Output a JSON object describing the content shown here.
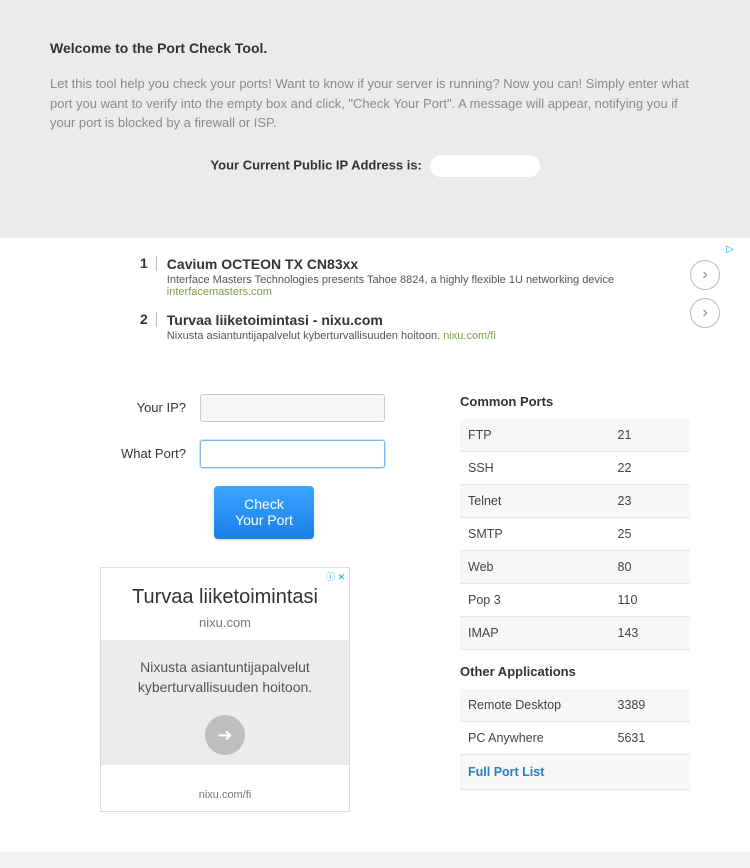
{
  "hero": {
    "title": "Welcome to the Port Check Tool.",
    "desc": "Let this tool help you check your ports! Want to know if your server is running? Now you can! Simply enter what port you want to verify into the empty box and click, \"Check Your Port\". A message will appear, notifying you if your port is blocked by a firewall or ISP.",
    "ip_label": "Your Current Public IP Address is:"
  },
  "ads_top": [
    {
      "num": "1",
      "title": "Cavium OCTEON TX CN83xx",
      "sub": "Interface Masters Technologies presents Tahoe 8824, a highly flexible 1U networking device",
      "domain": "interfacemasters.com"
    },
    {
      "num": "2",
      "title": "Turvaa liiketoimintasi - nixu.com",
      "sub": "Nixusta asiantuntijapalvelut kyberturvallisuuden hoitoon.",
      "domain": "nixu.com/fi"
    }
  ],
  "form": {
    "ip_label": "Your IP?",
    "ip_value": "",
    "port_label": "What Port?",
    "port_value": "",
    "button_l1": "Check",
    "button_l2": "Your Port"
  },
  "ad_block": {
    "title": "Turvaa liiketoimintasi",
    "sub": "nixu.com",
    "body": "Nixusta asiantuntijapalvelut kyberturvallisuuden hoitoon.",
    "footer": "nixu.com/fi"
  },
  "ports": {
    "common_heading": "Common Ports",
    "other_heading": "Other Applications",
    "common": [
      {
        "name": "FTP",
        "port": "21"
      },
      {
        "name": "SSH",
        "port": "22"
      },
      {
        "name": "Telnet",
        "port": "23"
      },
      {
        "name": "SMTP",
        "port": "25"
      },
      {
        "name": "Web",
        "port": "80"
      },
      {
        "name": "Pop 3",
        "port": "110"
      },
      {
        "name": "IMAP",
        "port": "143"
      }
    ],
    "other": [
      {
        "name": "Remote Desktop",
        "port": "3389"
      },
      {
        "name": "PC Anywhere",
        "port": "5631"
      }
    ],
    "full_link": "Full Port List"
  }
}
